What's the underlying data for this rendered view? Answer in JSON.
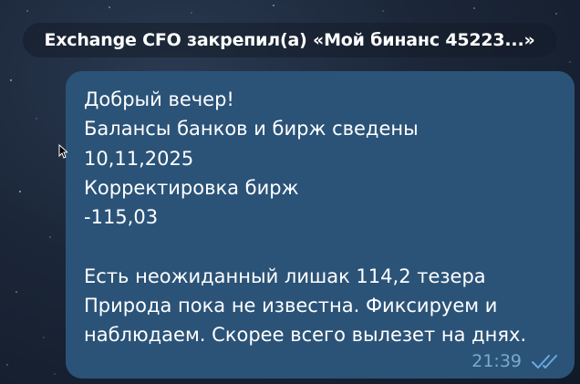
{
  "pinned_notice": {
    "text": "Exchange CFO закрепил(а) «Мой бинанс 45223...»"
  },
  "message": {
    "lines": [
      "Добрый вечер!",
      "Балансы банков и бирж сведены",
      "10,11,2025",
      "Корректировка бирж",
      "-115,03",
      "",
      "Есть неожиданный лишак 114,2 тезера",
      "Природа пока не известна. Фиксируем и",
      "наблюдаем. Скорее всего вылезет на днях."
    ],
    "time": "21:39",
    "status_icon": "double-check-icon"
  },
  "colors": {
    "bubble": "#2b5378",
    "time": "#7ea8cf",
    "check": "#6aa8e0",
    "background": "#1b2638"
  }
}
